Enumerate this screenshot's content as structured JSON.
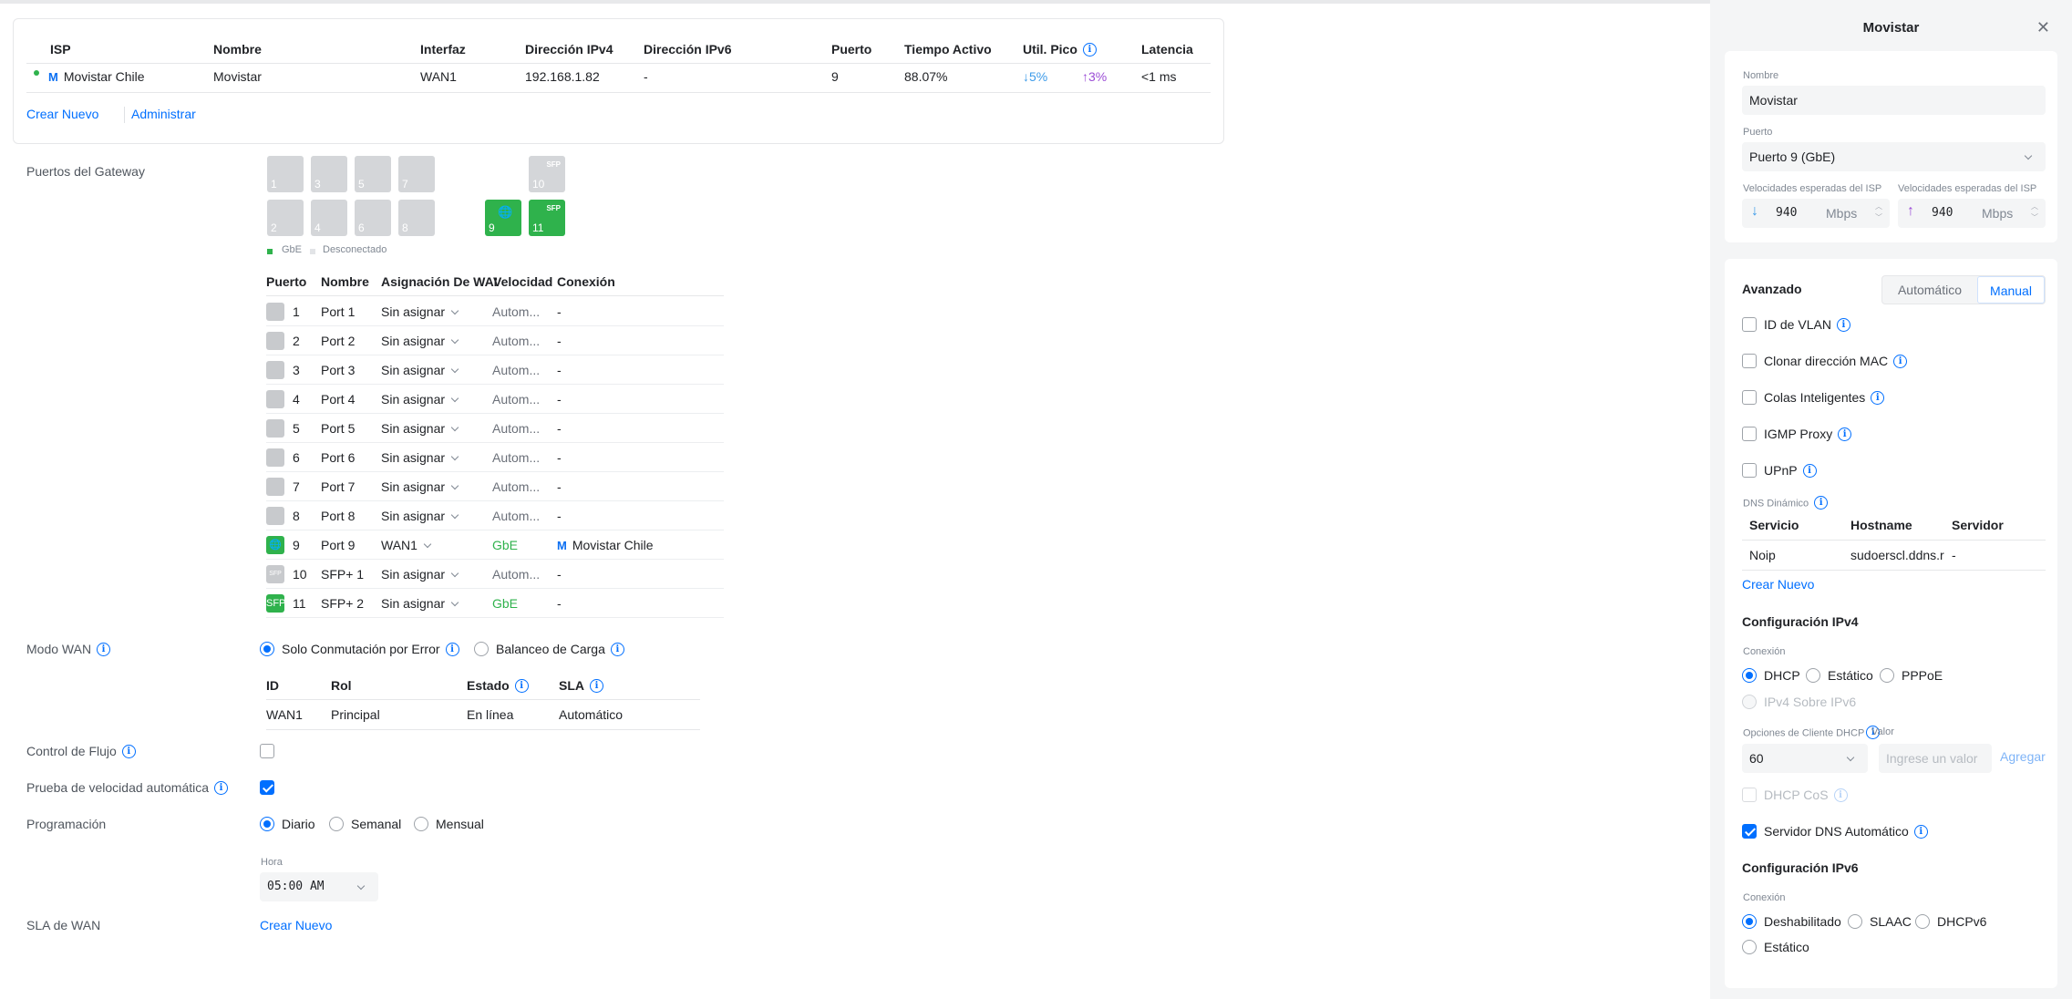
{
  "isp_table": {
    "headers": [
      "ISP",
      "Nombre",
      "Interfaz",
      "Dirección IPv4",
      "Dirección IPv6",
      "Puerto",
      "Tiempo Activo",
      "Util. Pico",
      "Latencia"
    ],
    "row": {
      "isp": "Movistar Chile",
      "name": "Movistar",
      "interface": "WAN1",
      "ipv4": "192.168.1.82",
      "ipv6": "-",
      "port": "9",
      "uptime": "88.07%",
      "peak_down": "↓5%",
      "peak_up": "↑3%",
      "latency": "<1 ms"
    },
    "create_new": "Crear Nuevo",
    "manage": "Administrar"
  },
  "gateway_ports": {
    "label": "Puertos del Gateway",
    "ports_top": [
      "1",
      "3",
      "5",
      "7"
    ],
    "ports_bottom": [
      "2",
      "4",
      "6",
      "8"
    ],
    "port9": "9",
    "port10": "10",
    "port11": "11",
    "sfp": "SFP",
    "legend_gbe": "GbE",
    "legend_disc": "Desconectado"
  },
  "ports_table": {
    "headers": [
      "Puerto",
      "Nombre",
      "Asignación De WAN",
      "Velocidad",
      "Conexión"
    ],
    "rows": [
      {
        "num": "1",
        "name": "Port 1",
        "assign": "Sin asignar",
        "speed": "Autom...",
        "conn": "-"
      },
      {
        "num": "2",
        "name": "Port 2",
        "assign": "Sin asignar",
        "speed": "Autom...",
        "conn": "-"
      },
      {
        "num": "3",
        "name": "Port 3",
        "assign": "Sin asignar",
        "speed": "Autom...",
        "conn": "-"
      },
      {
        "num": "4",
        "name": "Port 4",
        "assign": "Sin asignar",
        "speed": "Autom...",
        "conn": "-"
      },
      {
        "num": "5",
        "name": "Port 5",
        "assign": "Sin asignar",
        "speed": "Autom...",
        "conn": "-"
      },
      {
        "num": "6",
        "name": "Port 6",
        "assign": "Sin asignar",
        "speed": "Autom...",
        "conn": "-"
      },
      {
        "num": "7",
        "name": "Port 7",
        "assign": "Sin asignar",
        "speed": "Autom...",
        "conn": "-"
      },
      {
        "num": "8",
        "name": "Port 8",
        "assign": "Sin asignar",
        "speed": "Autom...",
        "conn": "-"
      },
      {
        "num": "9",
        "name": "Port 9",
        "assign": "WAN1",
        "speed": "GbE",
        "conn": "Movistar Chile"
      },
      {
        "num": "10",
        "name": "SFP+ 1",
        "assign": "Sin asignar",
        "speed": "Autom...",
        "conn": "-"
      },
      {
        "num": "11",
        "name": "SFP+ 2",
        "assign": "Sin asignar",
        "speed": "GbE",
        "conn": "-"
      }
    ]
  },
  "wan_mode": {
    "label": "Modo WAN",
    "opt_failover": "Solo Conmutación por Error",
    "opt_balance": "Balanceo de Carga",
    "headers": [
      "ID",
      "Rol",
      "Estado",
      "SLA"
    ],
    "row": {
      "id": "WAN1",
      "role": "Principal",
      "state": "En línea",
      "sla": "Automático"
    }
  },
  "flow_control": {
    "label": "Control de Flujo"
  },
  "speed_test": {
    "label": "Prueba de velocidad automática"
  },
  "schedule": {
    "label": "Programación",
    "daily": "Diario",
    "weekly": "Semanal",
    "monthly": "Mensual",
    "hour_label": "Hora",
    "hour_value": "05:00 AM"
  },
  "wan_sla": {
    "label": "SLA de WAN",
    "create_new": "Crear Nuevo"
  },
  "panel": {
    "title": "Movistar",
    "name_label": "Nombre",
    "name_value": "Movistar",
    "port_label": "Puerto",
    "port_value": "Puerto 9 (GbE)",
    "down_label": "Velocidades esperadas del ISP",
    "up_label": "Velocidades esperadas del ISP",
    "down_value": "940",
    "up_value": "940",
    "unit": "Mbps",
    "advanced": "Avanzado",
    "auto": "Automático",
    "manual": "Manual",
    "vlan": "ID de VLAN",
    "mac_clone": "Clonar dirección MAC",
    "smart_queues": "Colas Inteligentes",
    "igmp": "IGMP Proxy",
    "upnp": "UPnP",
    "ddns_label": "DNS Dinámico",
    "ddns_headers": [
      "Servicio",
      "Hostname",
      "Servidor"
    ],
    "ddns_row": {
      "service": "Noip",
      "hostname": "sudoerscl.ddns.r",
      "server": "-"
    },
    "create_new": "Crear Nuevo",
    "ipv4_title": "Configuración IPv4",
    "ipv4_conn_label": "Conexión",
    "ipv4_dhcp": "DHCP",
    "ipv4_static": "Estático",
    "ipv4_pppoe": "PPPoE",
    "ipv4_over_ipv6": "IPv4 Sobre IPv6",
    "dhcp_opts_label": "Opciones de Cliente DHCP",
    "value_label": "Valor",
    "dhcp_opt_value": "60",
    "value_placeholder": "Ingrese un valor",
    "add": "Agregar",
    "dhcp_cos": "DHCP CoS",
    "auto_dns": "Servidor DNS Automático",
    "ipv6_title": "Configuración IPv6",
    "ipv6_conn_label": "Conexión",
    "ipv6_disabled": "Deshabilitado",
    "ipv6_slaac": "SLAAC",
    "ipv6_dhcpv6": "DHCPv6",
    "ipv6_static": "Estático"
  },
  "colors": {
    "accent": "#006fff",
    "green": "#2fb24c",
    "port_gray": "#d4d6d9",
    "panel_bg": "#f4f5f6"
  }
}
